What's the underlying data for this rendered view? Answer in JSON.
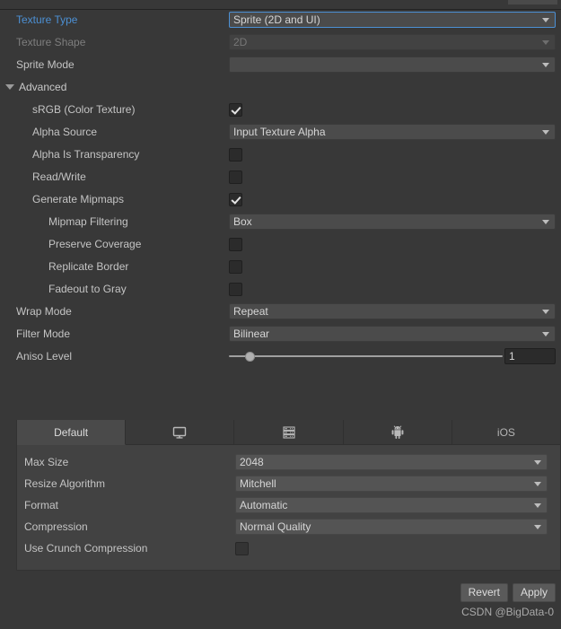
{
  "window": {
    "background_color": "#383838",
    "accent_color": "#4c90d4"
  },
  "general": {
    "rows": [
      {
        "label": "Texture Type",
        "label_style": "accent",
        "control": "dropdown",
        "value": "Sprite (2D and UI)",
        "focused": true,
        "disabled": false,
        "indent": 0
      },
      {
        "label": "Texture Shape",
        "label_style": "dim",
        "control": "dropdown",
        "value": "2D",
        "focused": false,
        "disabled": true,
        "indent": 0
      },
      {
        "label": "Sprite Mode",
        "label_style": "normal",
        "control": "dropdown",
        "value": "",
        "focused": false,
        "disabled": false,
        "indent": 0
      }
    ]
  },
  "advanced": {
    "title": "Advanced",
    "expanded": true,
    "foldout_icon": "triangle-down-icon",
    "rows": [
      {
        "label": "sRGB (Color Texture)",
        "control": "checkbox",
        "checked": true,
        "indent": 1
      },
      {
        "label": "Alpha Source",
        "control": "dropdown",
        "value": "Input Texture Alpha",
        "indent": 1
      },
      {
        "label": "Alpha Is Transparency",
        "control": "checkbox",
        "checked": false,
        "indent": 1
      },
      {
        "label": "Read/Write",
        "control": "checkbox",
        "checked": false,
        "indent": 1
      },
      {
        "label": "Generate Mipmaps",
        "control": "checkbox",
        "checked": true,
        "indent": 1
      },
      {
        "label": "Mipmap Filtering",
        "control": "dropdown",
        "value": "Box",
        "indent": 2
      },
      {
        "label": "Preserve Coverage",
        "control": "checkbox",
        "checked": false,
        "indent": 2
      },
      {
        "label": "Replicate Border",
        "control": "checkbox",
        "checked": false,
        "indent": 2
      },
      {
        "label": "Fadeout to Gray",
        "control": "checkbox",
        "checked": false,
        "indent": 2
      }
    ]
  },
  "sampling": {
    "rows": [
      {
        "label": "Wrap Mode",
        "control": "dropdown",
        "value": "Repeat",
        "indent": 0
      },
      {
        "label": "Filter Mode",
        "control": "dropdown",
        "value": "Bilinear",
        "indent": 0
      }
    ],
    "aniso": {
      "label": "Aniso Level",
      "value": "1",
      "slider_min": 0,
      "slider_max": 16,
      "slider_percent": 6
    }
  },
  "platform": {
    "tabs": [
      {
        "label": "Default",
        "icon": "",
        "active": true
      },
      {
        "label": "",
        "icon": "monitor-icon",
        "active": false
      },
      {
        "label": "",
        "icon": "webgl-icon",
        "active": false
      },
      {
        "label": "",
        "icon": "android-icon",
        "active": false
      },
      {
        "label": "iOS",
        "icon": "",
        "active": false
      }
    ],
    "rows": [
      {
        "label": "Max Size",
        "control": "dropdown",
        "value": "2048"
      },
      {
        "label": "Resize Algorithm",
        "control": "dropdown",
        "value": "Mitchell"
      },
      {
        "label": "Format",
        "control": "dropdown",
        "value": "Automatic"
      },
      {
        "label": "Compression",
        "control": "dropdown",
        "value": "Normal Quality"
      },
      {
        "label": "Use Crunch Compression",
        "control": "checkbox",
        "checked": false
      }
    ]
  },
  "footer": {
    "revert_label": "Revert",
    "apply_label": "Apply",
    "watermark": "CSDN @BigData-0"
  }
}
